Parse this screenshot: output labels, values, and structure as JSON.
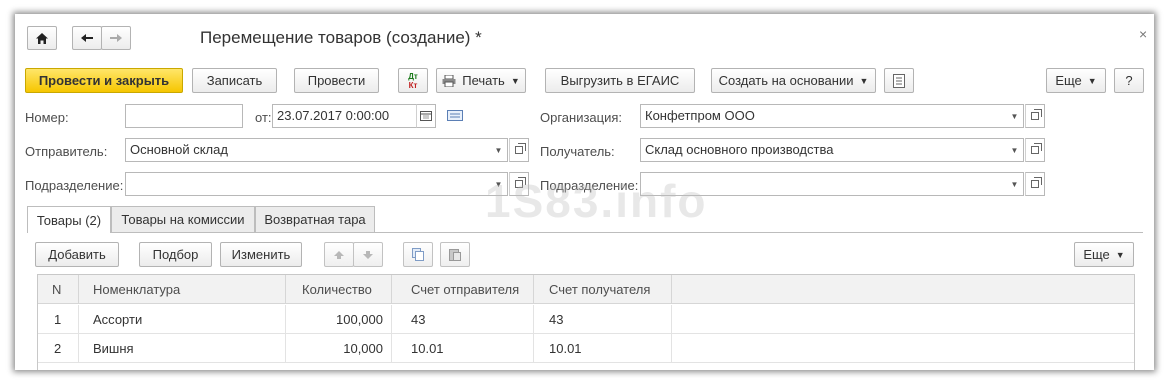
{
  "window": {
    "title": "Перемещение товаров (создание) *",
    "close": "×"
  },
  "nav": {
    "home": "⌂",
    "back": "🡐",
    "forward": "🡒"
  },
  "toolbar": {
    "post_and_close": "Провести и закрыть",
    "save": "Записать",
    "post": "Провести",
    "print": "Печать",
    "export_egais": "Выгрузить в ЕГАИС",
    "create_based_on": "Создать на основании",
    "more": "Еще",
    "help": "?",
    "dtkt_top": "Дт",
    "dtkt_bottom": "Кт"
  },
  "form": {
    "number_label": "Номер:",
    "number_value": "",
    "date_from_label": "от:",
    "date_value": "23.07.2017  0:00:00",
    "organization_label": "Организация:",
    "organization_value": "Конфетпром ООО",
    "sender_label": "Отправитель:",
    "sender_value": "Основной склад",
    "receiver_label": "Получатель:",
    "receiver_value": "Склад основного производства",
    "department_left_label": "Подразделение:",
    "department_left_value": "",
    "department_right_label": "Подразделение:",
    "department_right_value": ""
  },
  "tabs": [
    {
      "label": "Товары (2)",
      "active": true
    },
    {
      "label": "Товары на комиссии",
      "active": false
    },
    {
      "label": "Возвратная тара",
      "active": false
    }
  ],
  "table_toolbar": {
    "add": "Добавить",
    "selection": "Подбор",
    "change": "Изменить",
    "more": "Еще"
  },
  "table": {
    "columns": [
      "N",
      "Номенклатура",
      "Количество",
      "Счет отправителя",
      "Счет получателя"
    ],
    "rows": [
      {
        "n": "1",
        "item": "Ассорти",
        "qty": "100,000",
        "sender_acc": "43",
        "receiver_acc": "43"
      },
      {
        "n": "2",
        "item": "Вишня",
        "qty": "10,000",
        "sender_acc": "10.01",
        "receiver_acc": "10.01"
      }
    ]
  },
  "watermark": "1S83.info",
  "colors": {
    "primary_button": "#f6c600",
    "border": "#b8b8b8",
    "header_bg": "#f2f2f2"
  }
}
